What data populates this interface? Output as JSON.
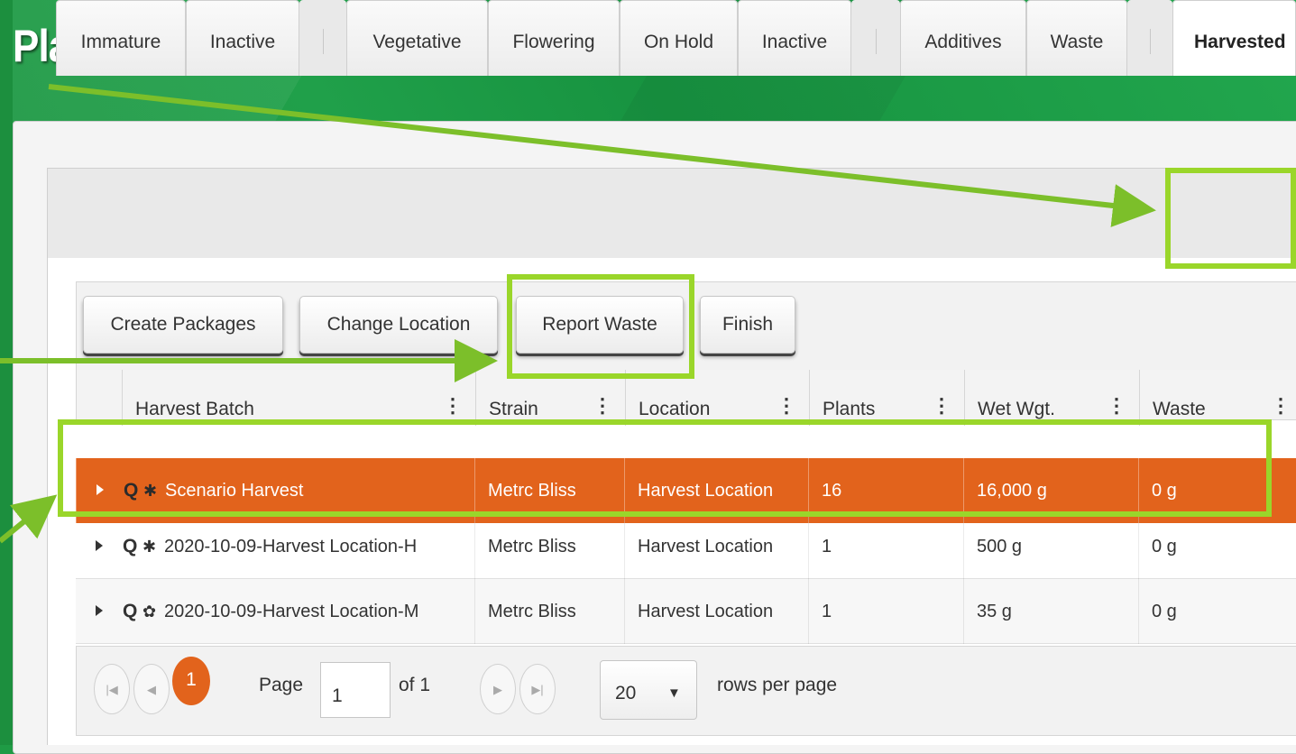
{
  "page": {
    "title": "Plants"
  },
  "tabs": {
    "items": [
      "Immature",
      "Inactive",
      "",
      "Vegetative",
      "Flowering",
      "On Hold",
      "Inactive",
      "",
      "Additives",
      "Waste",
      "",
      "Harvested"
    ],
    "active": "Harvested"
  },
  "toolbar": {
    "create_packages": "Create Packages",
    "change_location": "Change Location",
    "report_waste": "Report Waste",
    "finish": "Finish"
  },
  "grid": {
    "columns": [
      "Harvest Batch",
      "Strain",
      "Location",
      "Plants",
      "Wet Wgt.",
      "Waste"
    ],
    "menu_glyph": "⋮",
    "rows": [
      {
        "batch": "Scenario Harvest",
        "strain": "Metrc Bliss",
        "location": "Harvest Location",
        "plants": "16",
        "wet_weight": "16,000 g",
        "waste": "0 g",
        "icon": "asterisk-icon",
        "selected": true
      },
      {
        "batch": "2020-10-09-Harvest Location-H",
        "strain": "Metrc Bliss",
        "location": "Harvest Location",
        "plants": "1",
        "wet_weight": "500 g",
        "waste": "0 g",
        "icon": "asterisk-icon",
        "selected": false
      },
      {
        "batch": "2020-10-09-Harvest Location-M",
        "strain": "Metrc Bliss",
        "location": "Harvest Location",
        "plants": "1",
        "wet_weight": "35 g",
        "waste": "0 g",
        "icon": "gear-icon",
        "selected": false
      }
    ]
  },
  "pager": {
    "current_page": "1",
    "page_label": "Page",
    "page_input": "1",
    "of_label": "of 1",
    "page_size": "20",
    "rows_per_page_label": "rows per page"
  },
  "colors": {
    "selected_row": "#e2631c",
    "highlight": "#9ad62a",
    "arrow": "#7cbf2a",
    "background": "#1f9b45"
  }
}
